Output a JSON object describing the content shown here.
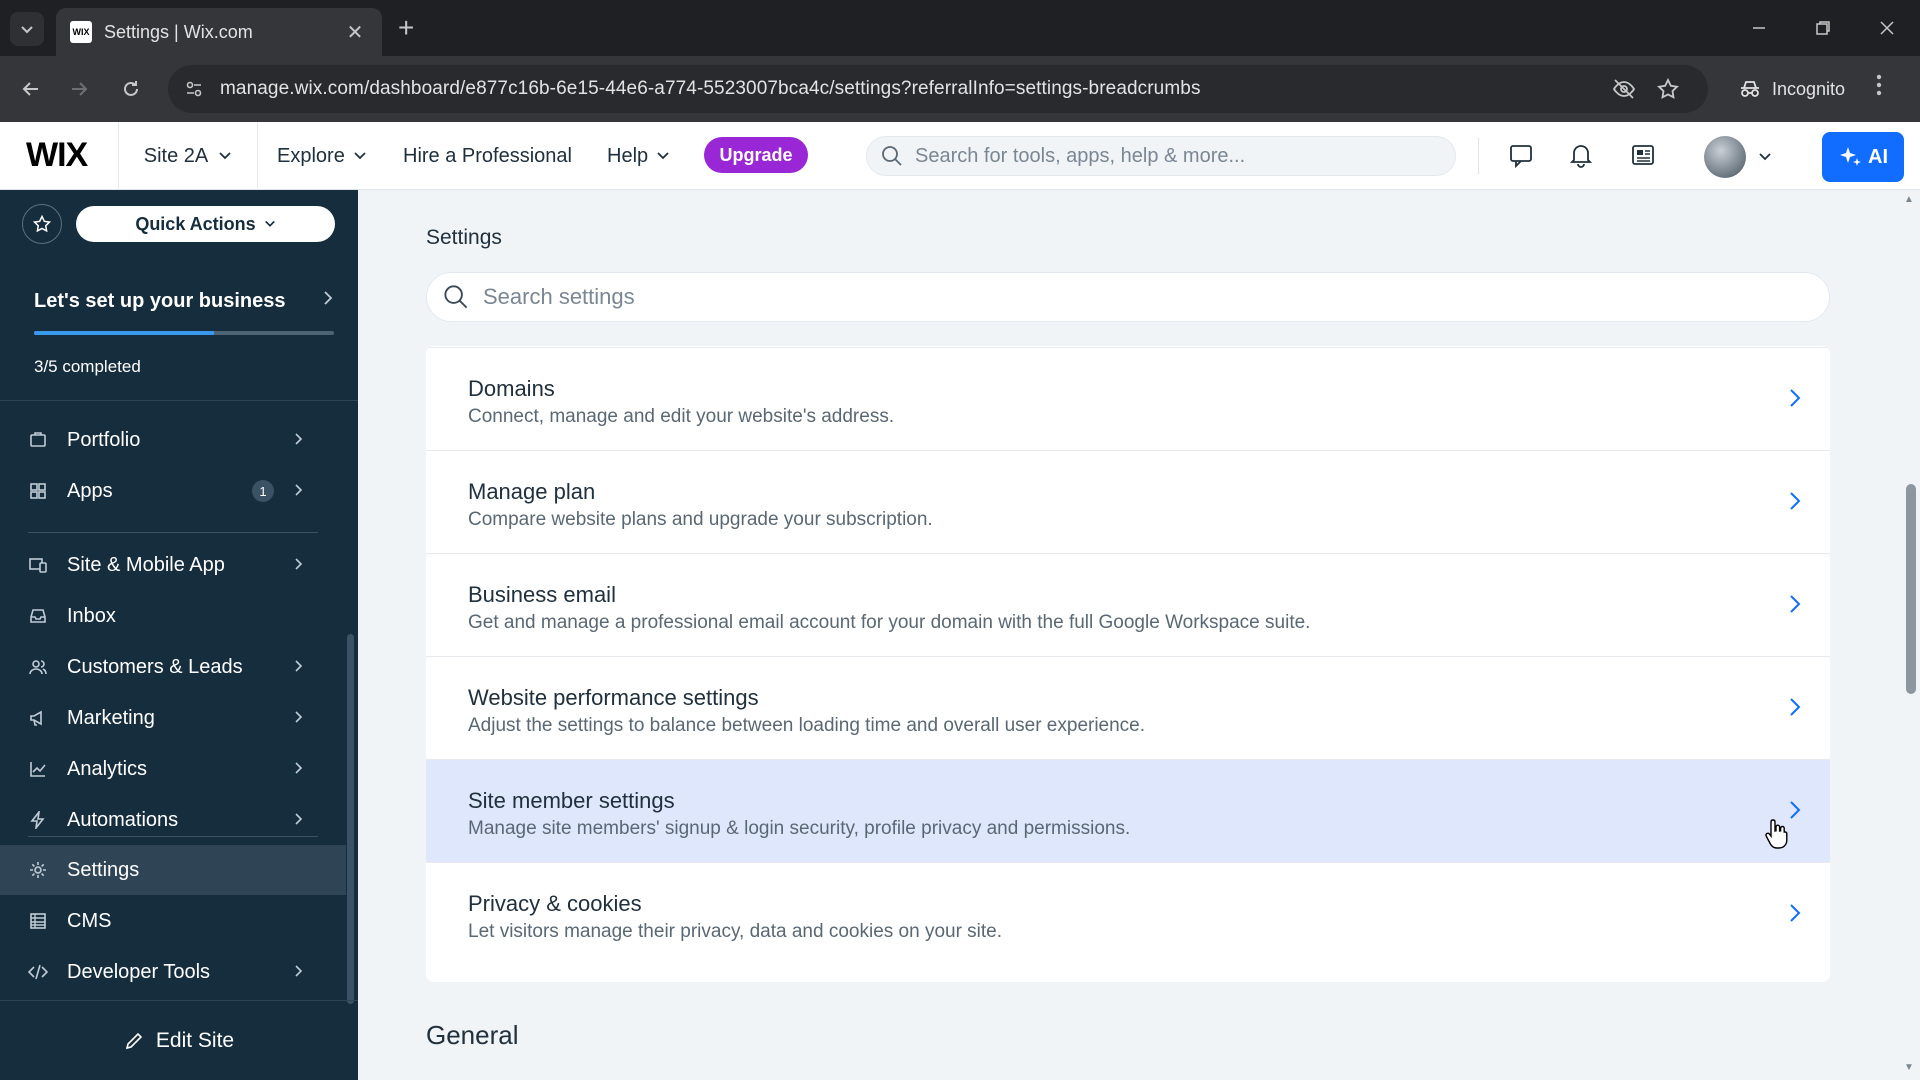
{
  "browser": {
    "tab_title": "Settings | Wix.com",
    "favicon_text": "WIX",
    "url": "manage.wix.com/dashboard/e877c16b-6e15-44e6-a774-5523007bca4c/settings?referralInfo=settings-breadcrumbs",
    "incognito_label": "Incognito"
  },
  "topbar": {
    "logo": "WIX",
    "site_name": "Site 2A",
    "explore": "Explore",
    "hire": "Hire a Professional",
    "help": "Help",
    "upgrade": "Upgrade",
    "search_placeholder": "Search for tools, apps, help & more...",
    "ai_label": "AI",
    "accent_color": "#116dff",
    "upgrade_color": "#9a27d5"
  },
  "sidebar": {
    "quick_actions": "Quick Actions",
    "setup_title": "Let's set up your business",
    "setup_progress": 0.6,
    "setup_count": "3/5 completed",
    "items": [
      {
        "label": "Portfolio",
        "icon": "portfolio-icon",
        "chevron": true
      },
      {
        "label": "Apps",
        "icon": "apps-icon",
        "chevron": true,
        "badge": "1"
      },
      {
        "label": "Site & Mobile App",
        "icon": "site-mobile-icon",
        "chevron": true
      },
      {
        "label": "Inbox",
        "icon": "inbox-icon",
        "chevron": false
      },
      {
        "label": "Customers & Leads",
        "icon": "customers-icon",
        "chevron": true
      },
      {
        "label": "Marketing",
        "icon": "megaphone-icon",
        "chevron": true
      },
      {
        "label": "Analytics",
        "icon": "chart-icon",
        "chevron": true
      },
      {
        "label": "Automations",
        "icon": "lightning-icon",
        "chevron": true
      },
      {
        "label": "Settings",
        "icon": "gear-icon",
        "chevron": false,
        "active": true
      },
      {
        "label": "CMS",
        "icon": "cms-icon",
        "chevron": false
      },
      {
        "label": "Developer Tools",
        "icon": "code-icon",
        "chevron": true
      }
    ],
    "edit_site": "Edit Site"
  },
  "main": {
    "title": "Settings",
    "search_placeholder": "Search settings",
    "rows": [
      {
        "title": "Domains",
        "desc": "Connect, manage and edit your website's address."
      },
      {
        "title": "Manage plan",
        "desc": "Compare website plans and upgrade your subscription."
      },
      {
        "title": "Business email",
        "desc": "Get and manage a professional email account for your domain with the full Google Workspace suite."
      },
      {
        "title": "Website performance settings",
        "desc": "Adjust the settings to balance between loading time and overall user experience."
      },
      {
        "title": "Site member settings",
        "desc": "Manage site members' signup & login security, profile privacy and permissions.",
        "hovered": true
      },
      {
        "title": "Privacy & cookies",
        "desc": "Let visitors manage their privacy, data and cookies on your site."
      }
    ],
    "section_general": "General"
  }
}
